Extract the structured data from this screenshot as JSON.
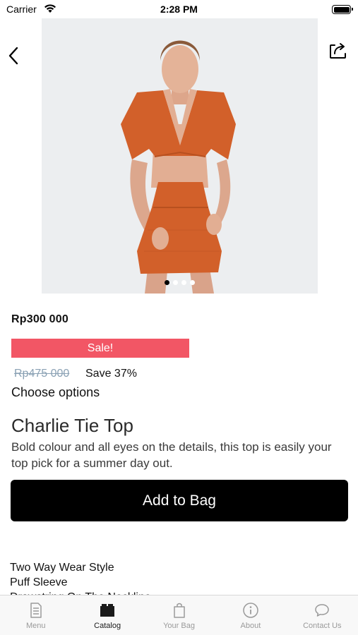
{
  "status_bar": {
    "carrier": "Carrier",
    "time": "2:28 PM"
  },
  "product": {
    "price": "Rp300 000",
    "sale_label": "Sale!",
    "original_price": "Rp475 000",
    "savings": "Save 37%",
    "choose_options": "Choose options",
    "title": "Charlie Tie Top",
    "description": "Bold colour and all eyes on the details, this top is easily your top pick for a summer day out.",
    "add_to_bag_label": "Add to Bag",
    "features": [
      "Two Way Wear Style",
      "Puff Sleeve",
      "Drawstring On The Neckline"
    ],
    "image_count": 4,
    "active_image_index": 0,
    "garment_color": "#d2602a"
  },
  "tabs": [
    {
      "label": "Menu",
      "icon": "menu-document-icon",
      "active": false
    },
    {
      "label": "Catalog",
      "icon": "catalog-folder-icon",
      "active": true
    },
    {
      "label": "Your Bag",
      "icon": "shopping-bag-icon",
      "active": false
    },
    {
      "label": "About",
      "icon": "info-circle-icon",
      "active": false
    },
    {
      "label": "Contact Us",
      "icon": "chat-bubble-icon",
      "active": false
    }
  ],
  "colors": {
    "sale": "#f25665",
    "button": "#000000",
    "tab_active": "#1a1a1a",
    "tab_inactive": "#9a9a9a"
  }
}
